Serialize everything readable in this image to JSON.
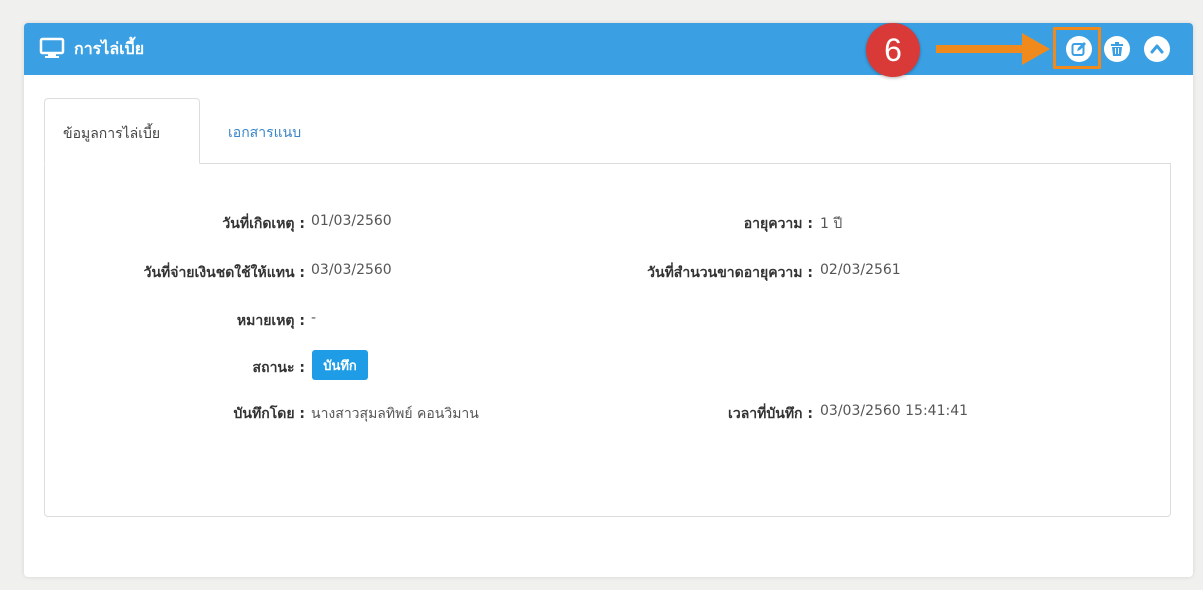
{
  "panel": {
    "title": "การไล่เบี้ย",
    "step_number": "6",
    "buttons": {
      "edit_icon": "edit-icon",
      "delete_icon": "trash-icon",
      "collapse_icon": "chevron-up-icon"
    }
  },
  "tabs": [
    {
      "label": "ข้อมูลการไล่เบี้ย",
      "active": true
    },
    {
      "label": "เอกสารแนบ",
      "active": false
    }
  ],
  "details": {
    "incident_date_label": "วันที่เกิดเหตุ :",
    "incident_date_value": "01/03/2560",
    "age_label": "อายุความ :",
    "age_value": "1 ปี",
    "payment_date_label": "วันที่จ่ายเงินชดใช้ให้แทน :",
    "payment_date_value": "03/03/2560",
    "expiry_date_label": "วันที่สำนวนขาดอายุความ :",
    "expiry_date_value": "02/03/2561",
    "note_label": "หมายเหตุ :",
    "note_value": "-",
    "status_label": "สถานะ :",
    "status_value": "บันทึก",
    "recorded_by_label": "บันทึกโดย :",
    "recorded_by_value": "นางสาวสุมลทิพย์ คอนวิมาน",
    "record_time_label": "เวลาที่บันทึก :",
    "record_time_value": "03/03/2560 15:41:41"
  },
  "colors": {
    "header": "#3aa0e3",
    "status_badge": "#1e9ce6",
    "callout": "#f08a1c",
    "step_badge": "#d93a37"
  }
}
